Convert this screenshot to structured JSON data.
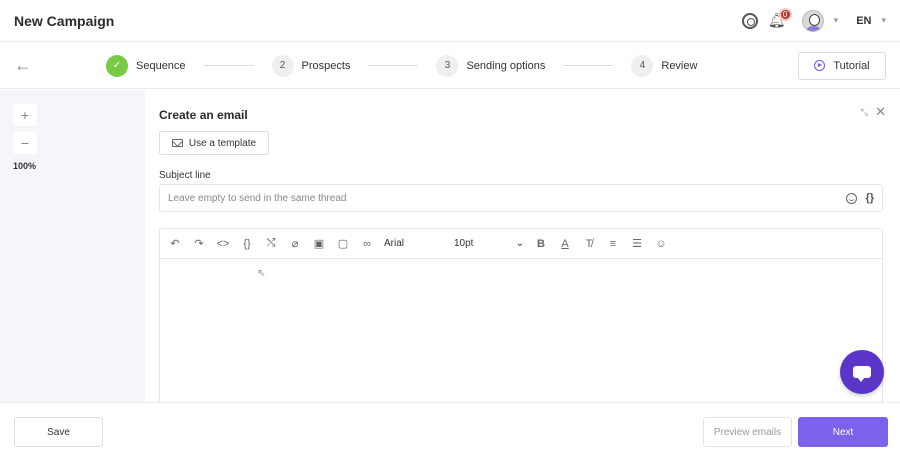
{
  "header": {
    "title": "New Campaign",
    "notification_count": "0",
    "language": "EN"
  },
  "stepper": {
    "steps": [
      {
        "number": "✓",
        "label": "Sequence",
        "state": "done"
      },
      {
        "number": "2",
        "label": "Prospects",
        "state": "pending"
      },
      {
        "number": "3",
        "label": "Sending options",
        "state": "pending"
      },
      {
        "number": "4",
        "label": "Review",
        "state": "pending"
      }
    ],
    "tutorial_label": "Tutorial"
  },
  "zoom": {
    "plus": "+",
    "minus": "−",
    "level": "100%"
  },
  "editor": {
    "title": "Create an email",
    "template_button": "Use a template",
    "subject_label": "Subject line",
    "subject_placeholder": "Leave empty to send in the same thread",
    "braces": "{}",
    "font": "Arial",
    "font_size": "10pt"
  },
  "footer": {
    "save_label": "Save",
    "preview_label": "Preview emails",
    "next_label": "Next"
  },
  "colors": {
    "accent": "#7b61ec",
    "success": "#7ac943",
    "chat": "#5b34c8"
  }
}
